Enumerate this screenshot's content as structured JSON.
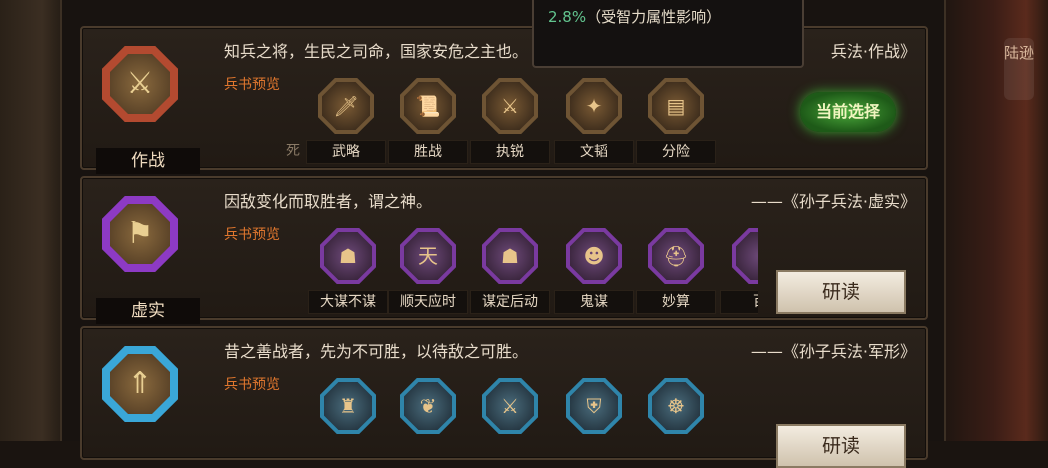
{
  "side_tag": "陆逊",
  "tooltip": {
    "value": "2.8%",
    "note": "（受智力属性影响）"
  },
  "cards": [
    {
      "title": "作战",
      "quote": "知兵之将，生民之司命，国家安危之主也。",
      "source": "兵法·作战》",
      "preview_label": "兵书预览",
      "skills": [
        "死",
        "武略",
        "胜战",
        "执锐",
        "文韬",
        "分险"
      ],
      "badge": "当前选择"
    },
    {
      "title": "虚实",
      "quote": "因敌变化而取胜者，谓之神。",
      "source": "——《孙子兵法·虚实》",
      "preview_label": "兵书预览",
      "skills": [
        "大谋不谋",
        "顺天应时",
        "谋定后动",
        "鬼谋",
        "妙算",
        "百"
      ],
      "button": "研读"
    },
    {
      "title": "",
      "quote": "昔之善战者，先为不可胜，以待敌之可胜。",
      "source": "——《孙子兵法·军形》",
      "preview_label": "兵书预览",
      "skills": [
        "",
        "",
        "",
        "",
        "",
        ""
      ],
      "button": "研读"
    }
  ]
}
